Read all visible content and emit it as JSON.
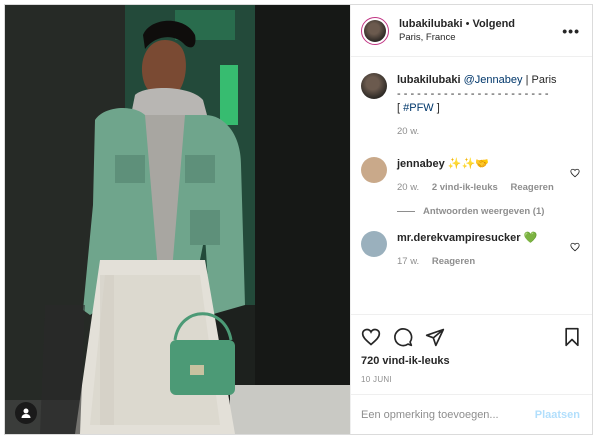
{
  "post": {
    "author": "lubakilubaki",
    "separator": "•",
    "follow_label": "Volgend",
    "location": "Paris, France",
    "more": "•••"
  },
  "caption": {
    "username": "lubakilubaki",
    "mention": "@Jennabey",
    "text_after_mention": " | Paris",
    "dashes": "- - - - - - - - - - - - - - - - - - - - - - -",
    "bracket_open": "[ ",
    "hashtag": "#PFW",
    "bracket_close": " ]",
    "time": "20 w."
  },
  "comments": [
    {
      "username": "jennabey",
      "text": "✨✨🤝",
      "time": "20 w.",
      "likes": "2 vind-ik-leuks",
      "reply": "Reageren",
      "view_replies": "Antwoorden weergeven (1)"
    },
    {
      "username": "mr.derekvampiresucker",
      "text": "💚",
      "time": "17 w.",
      "reply": "Reageren"
    }
  ],
  "actions": {
    "likes_count": "720 vind-ik-leuks",
    "date": "10 JUNI"
  },
  "add_comment": {
    "placeholder": "Een opmerking toevoegen...",
    "post_label": "Plaatsen"
  },
  "icons": {
    "like": "heart-icon",
    "comment": "comment-icon",
    "share": "share-icon",
    "save": "bookmark-icon",
    "user_tag": "user-tag-icon"
  }
}
